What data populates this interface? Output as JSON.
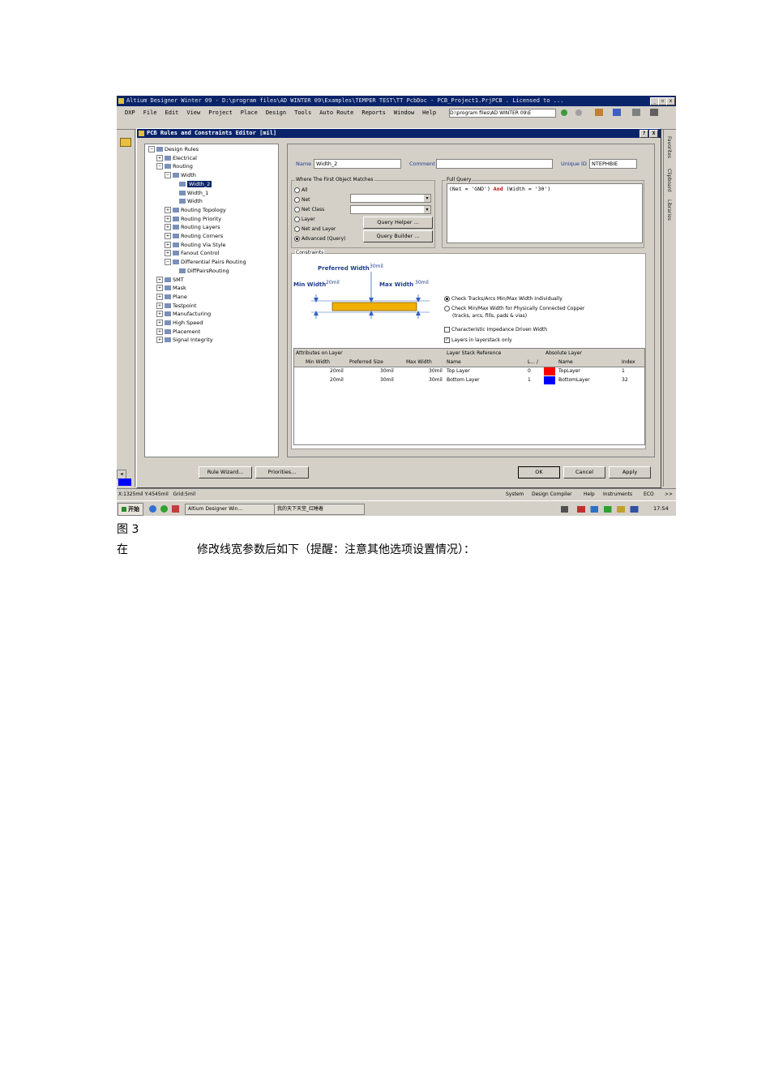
{
  "app": {
    "title": "Altium Designer Winter 09 - D:\\program files\\AD WINTER 09\\Examples\\TEMPER TEST\\TT PcbDoc - PCB_Project1.PrjPCB . Licensed to ..."
  },
  "menu": [
    "DXP",
    "File",
    "Edit",
    "View",
    "Project",
    "Place",
    "Design",
    "Tools",
    "Auto Route",
    "Reports",
    "Window",
    "Help"
  ],
  "path_box": "D:\\program files\\AD WINTER 09\\E",
  "side_tabs": [
    "Favorites",
    "Clipboard",
    "Libraries"
  ],
  "dialog": {
    "title": "PCB Rules and Constraints Editor [mil]",
    "help_btn": "?",
    "close_btn": "X"
  },
  "tree": [
    {
      "label": "Design Rules",
      "pm": "−"
    },
    {
      "label": "Electrical",
      "pm": "+"
    },
    {
      "label": "Routing",
      "pm": "−"
    },
    {
      "label": "Width",
      "pm": "−"
    },
    {
      "label": "Width_2",
      "pm": "",
      "selected": true
    },
    {
      "label": "Width_1",
      "pm": ""
    },
    {
      "label": "Width",
      "pm": ""
    },
    {
      "label": "Routing Topology",
      "pm": "+"
    },
    {
      "label": "Routing Priority",
      "pm": "+"
    },
    {
      "label": "Routing Layers",
      "pm": "+"
    },
    {
      "label": "Routing Corners",
      "pm": "+"
    },
    {
      "label": "Routing Via Style",
      "pm": "+"
    },
    {
      "label": "Fanout Control",
      "pm": "+"
    },
    {
      "label": "Differential Pairs Routing",
      "pm": "−"
    },
    {
      "label": "DiffPairsRouting",
      "pm": ""
    },
    {
      "label": "SMT",
      "pm": "+"
    },
    {
      "label": "Mask",
      "pm": "+"
    },
    {
      "label": "Plane",
      "pm": "+"
    },
    {
      "label": "Testpoint",
      "pm": "+"
    },
    {
      "label": "Manufacturing",
      "pm": "+"
    },
    {
      "label": "High Speed",
      "pm": "+"
    },
    {
      "label": "Placement",
      "pm": "+"
    },
    {
      "label": "Signal Integrity",
      "pm": "+"
    }
  ],
  "rule": {
    "name_label": "Name",
    "name_value": "Width_2",
    "comment_label": "Comment",
    "comment_value": "",
    "uid_label": "Unique ID",
    "uid_value": "NTEPHBIE"
  },
  "where": {
    "title": "Where The First Object Matches",
    "options": [
      "All",
      "Net",
      "Net Class",
      "Layer",
      "Net and Layer",
      "Advanced (Query)"
    ],
    "selected": "Advanced (Query)",
    "query_helper": "Query Helper ...",
    "query_builder": "Query Builder ..."
  },
  "full_query": {
    "title": "Full Query",
    "p1": "(Net = 'GND') ",
    "kw": "And",
    "p2": " (Width = '30')"
  },
  "constraints": {
    "title": "Constraints",
    "preferred_label": "Preferred Width",
    "preferred_value": "30mil",
    "min_label": "Min Width",
    "min_value": "20mil",
    "max_label": "Max Width",
    "max_value": "30mil",
    "opt1": "Check Tracks/Arcs Min/Max Width Individually",
    "opt2_line1": "Check Min/Max Width for Physically Connected Copper",
    "opt2_line2": "(tracks, arcs, fills, pads & vias)",
    "chk1": "Characteristic Impedance Driven Width",
    "chk2": "Layers in layerstack only"
  },
  "table": {
    "group_attr": "Attributes on Layer",
    "group_stack": "Layer Stack Reference",
    "group_abs": "Absolute Layer",
    "headers": [
      "Min Width",
      "Preferred Size",
      "Max Width",
      "Name",
      "L... /",
      "Name",
      "Index"
    ],
    "rows": [
      {
        "min": "20mil",
        "pref": "30mil",
        "max": "30mil",
        "name": "Top Layer",
        "l": "0",
        "color": "#ff0000",
        "abs_name": "TopLayer",
        "index": "1"
      },
      {
        "min": "20mil",
        "pref": "30mil",
        "max": "30mil",
        "name": "Bottom Layer",
        "l": "1",
        "color": "#0000ff",
        "abs_name": "BottomLayer",
        "index": "32"
      }
    ]
  },
  "buttons": {
    "rule_wizard": "Rule Wizard...",
    "priorities": "Priorities...",
    "ok": "OK",
    "cancel": "Cancel",
    "apply": "Apply"
  },
  "status": {
    "coords": "X:1325mil Y:4545mil   Grid:5mil",
    "items": [
      "System",
      "Design Compiler",
      "Help",
      "Instruments",
      "ECO",
      ">>"
    ]
  },
  "taskbar": {
    "start": "开始",
    "tasks": [
      "Altium Designer Win...",
      "我的天下天堂_红睡着"
    ],
    "clock": "17:54"
  },
  "caption": {
    "figure": "图 3",
    "text_prefix": "在",
    "text_body": "修改线宽参数后如下（提醒：注意其他选项设置情况）："
  }
}
